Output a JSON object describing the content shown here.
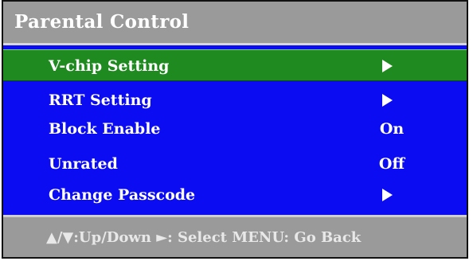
{
  "menu": {
    "title": "Parental Control",
    "items": [
      {
        "label": "V-chip Setting",
        "value": null,
        "has_arrow": true,
        "selected": true
      },
      {
        "label": "RRT Setting",
        "value": null,
        "has_arrow": true,
        "selected": false
      },
      {
        "label": "Block Enable",
        "value": "On",
        "has_arrow": false,
        "selected": false
      },
      {
        "label": "Unrated",
        "value": "Off",
        "has_arrow": false,
        "selected": false
      },
      {
        "label": "Change Passcode",
        "value": null,
        "has_arrow": true,
        "selected": false
      }
    ]
  },
  "footer": {
    "hint": "▲/▼:Up/Down ►: Select MENU: Go Back"
  },
  "colors": {
    "menu_background": "#0c0cf2",
    "selected_row": "#1f8a1f",
    "bar_gray": "#9a9a9a",
    "text": "#ffffff"
  }
}
